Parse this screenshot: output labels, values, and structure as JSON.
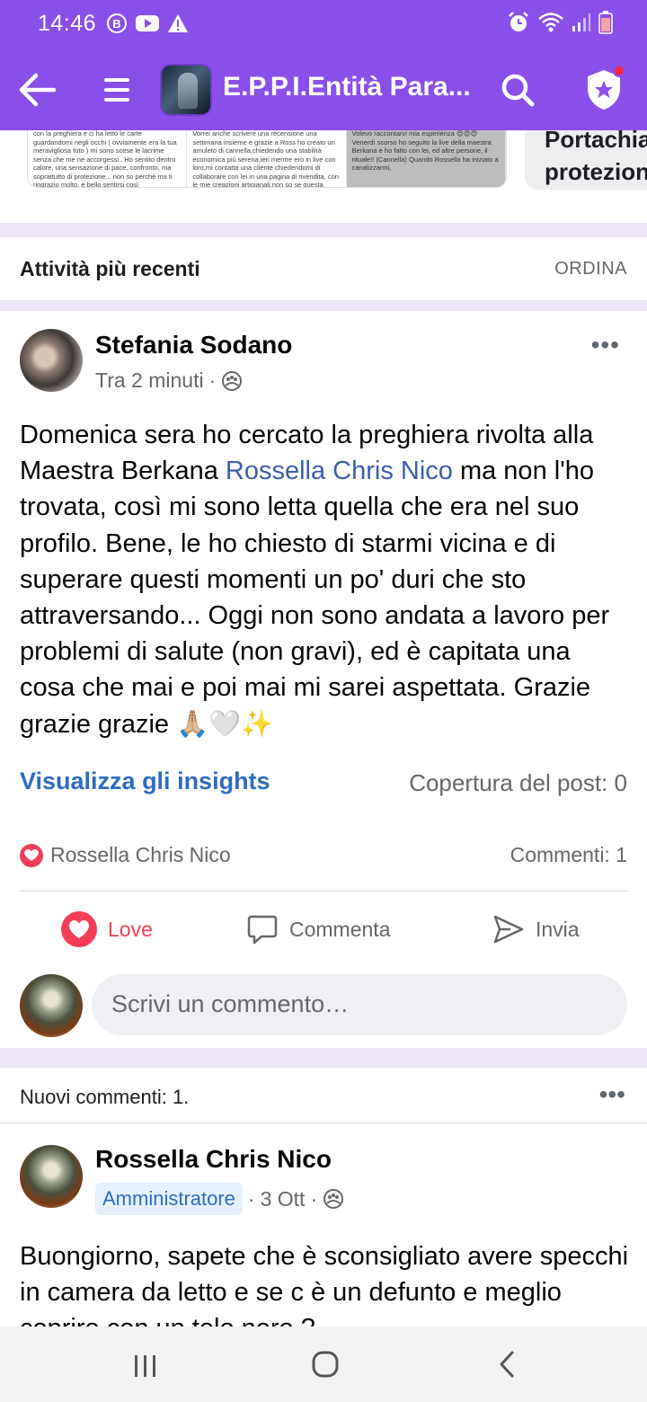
{
  "status_bar": {
    "time": "14:46",
    "left_icons": [
      "b-circle-icon",
      "youtube-icon",
      "alert-icon"
    ],
    "right_icons": [
      "alarm-icon",
      "wifi-icon",
      "signal-icon",
      "battery-icon"
    ]
  },
  "app_bar": {
    "group_title": "E.P.P.I.Entità Para...",
    "accent_color": "#8a4fe8",
    "notification_dot_color": "#f0284a"
  },
  "carousel": {
    "card1_col1": "con la preghiera e ci ha letto le carte guardandomi negli occhi ( ovviamente era la tua meravigliosa foto ) mi sono scese le lacrime senza che me ne accorgessi.. Ho sentito dentro calore, una sensazione di pace, confronto, ma soprattutto di protezione... non so perchè ma ti ringrazio molto, è bello sentirsi così",
    "card1_col2": "Vorrei anche scrivere una recensione una settimana insieme e grazie a Ross ho creato un amuleto di cannella,chiedendo una stabilità economica più serena,ieri mentre ero in live con loro,mi contatta una cliente chiedendomi di collaborare con lei in una pagina di rivendita, con le mie creazioni artigianali,non so se questa",
    "card1_col3": "Volevo raccontarvi mia esperienza 😍😍😍 Venerdì scorso ho seguito la live della maestra Berkana e ho fatto con lei, ed altre persone, il rituale!! (Cannella) Quando Rossella ha iniziato a canalizzarmi,",
    "card2_title": "Portachia protezion"
  },
  "section": {
    "title": "Attività più recenti",
    "sort_label": "ORDINA"
  },
  "post": {
    "author": "Stefania Sodano",
    "time": "Tra 2 minuti",
    "text_part1": "Domenica sera ho cercato la preghiera rivolta alla Maestra Berkana ",
    "mention": "Rossella Chris Nico",
    "text_part2": "  ma non l'ho trovata, così mi sono letta quella che era nel suo profilo. Bene, le ho chiesto di starmi vicina e di superare questi momenti un po' duri che sto attraversando... Oggi non sono andata a lavoro per problemi di salute (non gravi), ed è capitata una cosa che mai e poi mai mi sarei aspettata. Grazie grazie grazie 🙏🏼🤍✨",
    "insights_label": "Visualizza gli insights",
    "reach_label": "Copertura del post: 0",
    "reactor": "Rossella Chris Nico",
    "comments_count": "Commenti: 1",
    "actions": {
      "love": "Love",
      "comment": "Commenta",
      "send": "Invia"
    },
    "comment_placeholder": "Scrivi un commento…"
  },
  "new_comments": {
    "label": "Nuovi commenti: 1."
  },
  "post2": {
    "author": "Rossella Chris Nico",
    "badge": "Amministratore",
    "time": "3 Ott",
    "text": "Buongiorno, sapete che è sconsigliato avere specchi in camera da letto e se c è un defunto e meglio coprire con un telo nero ?"
  },
  "colors": {
    "link_blue": "#2f6bc0",
    "love_red": "#f33e58",
    "separator": "#ece6f6"
  }
}
